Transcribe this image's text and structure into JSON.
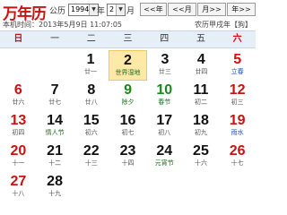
{
  "app": {
    "title": "万年历"
  },
  "controls": {
    "gongli_label": "公历",
    "year_value": "1994",
    "year_label": "年",
    "month_value": "2",
    "month_label": "月",
    "nav": [
      "<<年",
      "<<月",
      "月>>",
      "年>>"
    ]
  },
  "info": {
    "local_time": "本机时间：2013年5月9日 11:07:05",
    "lunar_year": "农历甲戌年【狗】"
  },
  "week_days": [
    "日",
    "一",
    "二",
    "三",
    "四",
    "五",
    "六"
  ],
  "calendar": {
    "rows": [
      [
        {
          "day": "",
          "sub": ""
        },
        {
          "day": "",
          "sub": ""
        },
        {
          "day": "1",
          "sub": "廿一"
        },
        {
          "day": "2",
          "sub": "世界湿地",
          "today": true
        },
        {
          "day": "3",
          "sub": "廿三"
        },
        {
          "day": "4",
          "sub": "廿四"
        },
        {
          "day": "5",
          "sub": "立春",
          "red": true,
          "subtype": "term"
        }
      ],
      [
        {
          "day": "6",
          "sub": "廿六",
          "red": true
        },
        {
          "day": "7",
          "sub": "廿七"
        },
        {
          "day": "8",
          "sub": "廿八"
        },
        {
          "day": "9",
          "sub": "除夕",
          "green": true,
          "subtype": "festival"
        },
        {
          "day": "10",
          "sub": "春节",
          "green": true,
          "subtype": "festival"
        },
        {
          "day": "11",
          "sub": "初二"
        },
        {
          "day": "12",
          "sub": "初三",
          "red": true
        }
      ],
      [
        {
          "day": "13",
          "sub": "初四",
          "red": true
        },
        {
          "day": "14",
          "sub": "情人节",
          "subtype": "festival"
        },
        {
          "day": "15",
          "sub": "初六"
        },
        {
          "day": "16",
          "sub": "初七"
        },
        {
          "day": "17",
          "sub": "初八"
        },
        {
          "day": "18",
          "sub": "初九"
        },
        {
          "day": "19",
          "sub": "雨水",
          "red": true,
          "subtype": "term"
        }
      ],
      [
        {
          "day": "20",
          "sub": "十一",
          "red": true
        },
        {
          "day": "21",
          "sub": "十二"
        },
        {
          "day": "22",
          "sub": "十三"
        },
        {
          "day": "23",
          "sub": "十四"
        },
        {
          "day": "24",
          "sub": "元宵节",
          "subtype": "festival"
        },
        {
          "day": "25",
          "sub": "十六"
        },
        {
          "day": "26",
          "sub": "十七",
          "red": true
        }
      ],
      [
        {
          "day": "27",
          "sub": "十八",
          "red": true
        },
        {
          "day": "28",
          "sub": "十九"
        },
        {
          "day": "",
          "sub": ""
        },
        {
          "day": "",
          "sub": ""
        },
        {
          "day": "",
          "sub": ""
        },
        {
          "day": "",
          "sub": ""
        },
        {
          "day": "",
          "sub": ""
        }
      ]
    ]
  },
  "colors": {
    "accent_red": "#cc1111",
    "festival_green": "#188a18",
    "today_highlight": "#ffe9a8",
    "header_bg": "#e6eef8"
  }
}
